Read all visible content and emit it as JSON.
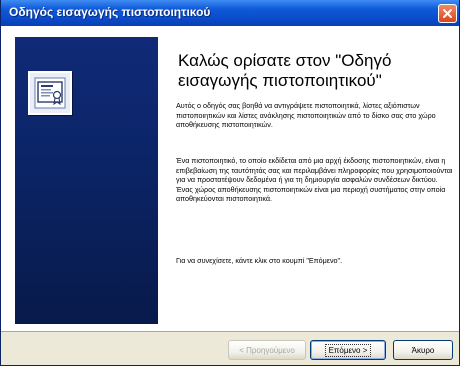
{
  "window": {
    "title": "Οδηγός εισαγωγής πιστοποιητικού",
    "close_icon": "close-icon"
  },
  "banner": {
    "icon": "certificate-icon",
    "color": "#0b2466"
  },
  "content": {
    "heading": "Καλώς ορίσατε στον \"Οδηγό εισαγωγής πιστοποιητικού\"",
    "paragraph1": "Αυτός ο οδηγός σας βοηθά να αντιγράψετε πιστοποιητικά, λίστες αξιόπιστων πιστοποιητικών και λίστες ανάκλησης πιστοποιητικών από το δίσκο σας στο χώρο αποθήκευσης πιστοποιητικών.",
    "paragraph2": "Ένα πιστοποιητικό, το οποίο εκδίδεται από μια αρχή έκδοσης πιστοποιητικών, είναι η επιβεβαίωση της ταυτότητάς σας και περιλαμβάνει πληροφορίες που χρησιμοποιούνται για να προστατέψουν δεδομένα ή για τη δημιουργία ασφαλών συνδέσεων δικτύου. Ένας χώρος αποθήκευσης πιστοποιητικών είναι μια περιοχή συστήματος στην οποία αποθηκεύονται πιστοποιητικά.",
    "paragraph3": "Για να συνεχίσετε, κάντε κλικ στο κουμπί \"Επόμενο\"."
  },
  "buttons": {
    "back_label": "< Προηγούμενο",
    "next_label": "Επόμενο >",
    "cancel_label": "Άκυρο"
  },
  "colors": {
    "titlebar": "#0a4ccc",
    "close": "#d8461c"
  }
}
